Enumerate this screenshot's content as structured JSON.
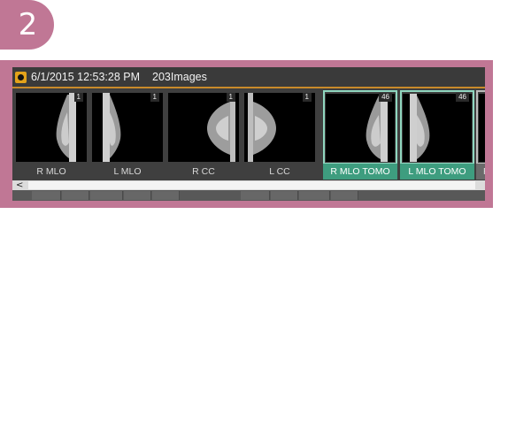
{
  "step_number": "2",
  "header": {
    "datetime": "6/1/2015 12:53:28 PM",
    "image_count": "203Images"
  },
  "thumbnails": [
    {
      "label": "R MLO",
      "count": "1",
      "selected": false
    },
    {
      "label": "L MLO",
      "count": "1",
      "selected": false
    },
    {
      "label": "R CC",
      "count": "1",
      "selected": false
    },
    {
      "label": "L CC",
      "count": "1",
      "selected": false
    },
    {
      "label": "R MLO TOMO",
      "count": "46",
      "selected": true
    },
    {
      "label": "L MLO TOMO",
      "count": "46",
      "selected": true
    },
    {
      "label": "R C",
      "count": "",
      "selected": false
    }
  ],
  "scroll_left_glyph": "<",
  "colors": {
    "badge": "#c07795",
    "frame": "#c07795",
    "header_accent": "#c98a2a",
    "selected_border": "#8fd6bf",
    "selected_label_bg": "#3e9d7f"
  }
}
